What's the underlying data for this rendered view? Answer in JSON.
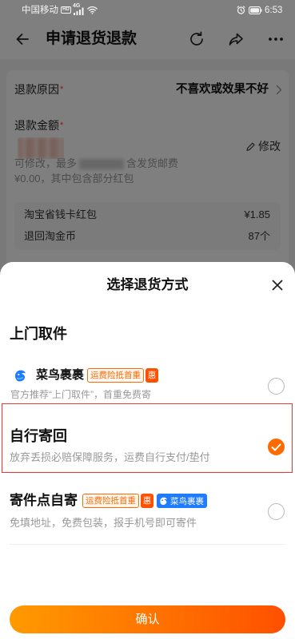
{
  "status_bar": {
    "carrier": "中国移动",
    "hd_badge": "HD",
    "network": "4G",
    "time": "6:53"
  },
  "header": {
    "title": "申请退货退款"
  },
  "refund": {
    "reason": {
      "label": "退款原因",
      "required_mark": "*",
      "value": "不喜欢或效果不好"
    },
    "amount": {
      "label": "退款金额",
      "required_mark": "*",
      "edit_label": "修改",
      "note_prefix": "可修改，最多",
      "note_suffix": "含发货邮费",
      "note_detail": "¥0.00，其中包含部分红包"
    },
    "breakdown": [
      {
        "label": "淘宝省钱卡红包",
        "value": "¥1.85"
      },
      {
        "label": "退回淘金币",
        "value": "87个"
      }
    ]
  },
  "return_sheet": {
    "title": "选择退货方式",
    "pickup_section_title": "上门取件",
    "options": [
      {
        "name": "菜鸟裹裹",
        "badges": [
          "运费险抵首重",
          "惠"
        ],
        "description": "官方推荐“上门取件”，首重免费寄",
        "selected": false
      },
      {
        "name": "自行寄回",
        "description": "放弃丢损必赔保障服务，运费自行支付/垫付",
        "selected": true
      },
      {
        "name": "寄件点自寄",
        "badges": [
          "运费险抵首重",
          "惠"
        ],
        "partner_badge": "菜鸟裹裹",
        "description": "免填地址，免费包装，报手机号即可寄件",
        "selected": false
      }
    ],
    "confirm_label": "确认"
  },
  "icons": {
    "back": "back-arrow-icon",
    "refresh": "refresh-icon",
    "share": "share-icon",
    "more": "more-icon",
    "reason_chevron": "chevron-right-icon",
    "edit": "pencil-icon",
    "close": "close-icon",
    "cainiao": "cainiao-logo-icon",
    "selected": "checkmark-icon"
  },
  "colors": {
    "accent": "#ff6a00",
    "badge_fill": "#ff5000",
    "partner_blue": "#1f7bff",
    "highlight_border": "#e53935",
    "required_mark": "#ff3b30"
  }
}
